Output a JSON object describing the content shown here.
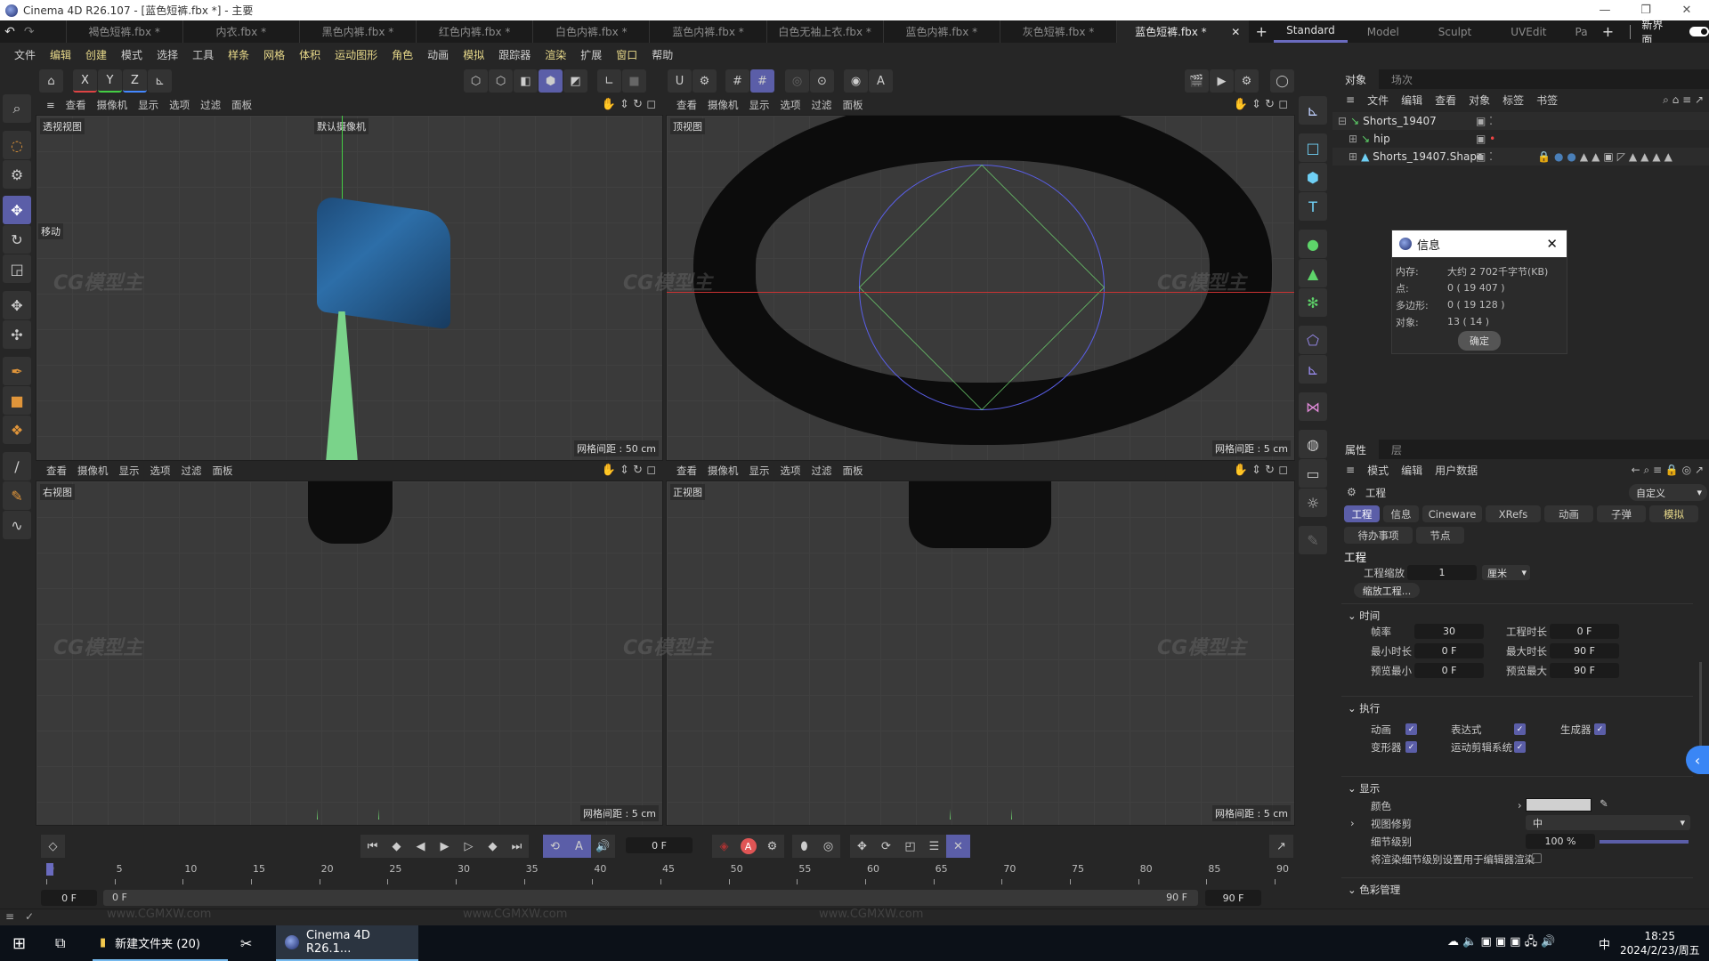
{
  "window": {
    "title": "Cinema 4D R26.107 - [蓝色短裤.fbx *] - 主要",
    "minimize": "—",
    "maximize": "❐",
    "close": "✕"
  },
  "file_tabs": [
    {
      "label": "褐色短裤.fbx *",
      "active": false
    },
    {
      "label": "内衣.fbx *",
      "active": false
    },
    {
      "label": "黑色内裤.fbx *",
      "active": false
    },
    {
      "label": "红色内裤.fbx *",
      "active": false
    },
    {
      "label": "白色内裤.fbx *",
      "active": false
    },
    {
      "label": "蓝色内裤.fbx *",
      "active": false
    },
    {
      "label": "白色无袖上衣.fbx *",
      "active": false
    },
    {
      "label": "蓝色内裤.fbx *",
      "active": false
    },
    {
      "label": "灰色短裤.fbx *",
      "active": false
    },
    {
      "label": "蓝色短裤.fbx *",
      "active": true
    }
  ],
  "layouts": [
    {
      "label": "Standard",
      "active": true
    },
    {
      "label": "Model",
      "active": false
    },
    {
      "label": "Sculpt",
      "active": false
    },
    {
      "label": "UVEdit",
      "active": false
    },
    {
      "label": "Pa",
      "active": false
    }
  ],
  "new_ui_label": "新界面",
  "menu": [
    {
      "label": "文件",
      "hl": false
    },
    {
      "label": "编辑",
      "hl": true
    },
    {
      "label": "创建",
      "hl": true
    },
    {
      "label": "模式",
      "hl": false
    },
    {
      "label": "选择",
      "hl": false
    },
    {
      "label": "工具",
      "hl": false
    },
    {
      "label": "样条",
      "hl": true
    },
    {
      "label": "网格",
      "hl": true
    },
    {
      "label": "体积",
      "hl": true
    },
    {
      "label": "运动图形",
      "hl": true
    },
    {
      "label": "角色",
      "hl": true
    },
    {
      "label": "动画",
      "hl": false
    },
    {
      "label": "模拟",
      "hl": true
    },
    {
      "label": "跟踪器",
      "hl": false
    },
    {
      "label": "渲染",
      "hl": true
    },
    {
      "label": "扩展",
      "hl": false
    },
    {
      "label": "窗口",
      "hl": true
    },
    {
      "label": "帮助",
      "hl": false
    }
  ],
  "toolbar": {
    "x": "X",
    "y": "Y",
    "z": "Z"
  },
  "viewport_menu": [
    "查看",
    "摄像机",
    "显示",
    "选项",
    "过滤",
    "面板"
  ],
  "viewports": {
    "perspective": {
      "label": "透视视图",
      "camera": "默认摄像机",
      "grid": "网格间距 : 50 cm",
      "tool_hint": "移动"
    },
    "top": {
      "label": "顶视图",
      "grid": "网格间距 : 5 cm"
    },
    "right": {
      "label": "右视图",
      "grid": "网格间距 : 5 cm"
    },
    "front": {
      "label": "正视图",
      "grid": "网格间距 : 5 cm"
    }
  },
  "object_manager": {
    "tabs": [
      "对象",
      "场次"
    ],
    "menu": [
      "文件",
      "编辑",
      "查看",
      "对象",
      "标签",
      "书签"
    ],
    "objects": [
      {
        "name": "Shorts_19407",
        "indent": 0
      },
      {
        "name": "hip",
        "indent": 1
      },
      {
        "name": "Shorts_19407.Shape",
        "indent": 1
      }
    ]
  },
  "info_dialog": {
    "title": "信息",
    "rows": [
      {
        "key": "内存:",
        "value": "大约 2 702千字节(KB)"
      },
      {
        "key": "点:",
        "value": "0 ( 19 407 )"
      },
      {
        "key": "多边形:",
        "value": "0 ( 19 128 )"
      },
      {
        "key": "对象:",
        "value": "13 ( 14 )"
      }
    ],
    "ok": "确定"
  },
  "attributes": {
    "tabs": [
      "属性",
      "层"
    ],
    "menu": [
      "模式",
      "编辑",
      "用户数据"
    ],
    "title": "工程",
    "preset": "自定义",
    "page_tabs": [
      "工程",
      "信息",
      "Cineware",
      "XRefs",
      "动画",
      "子弹",
      "模拟",
      "待办事项",
      "节点"
    ],
    "section": "工程",
    "scale_label": "工程缩放",
    "scale_value": "1",
    "scale_unit": "厘米",
    "scale_button": "缩放工程...",
    "time": {
      "header": "时间",
      "fps_label": "帧率",
      "fps": "30",
      "proj_len_label": "工程时长",
      "proj_len": "0 F",
      "min_label": "最小时长",
      "min": "0 F",
      "max_label": "最大时长",
      "max": "90 F",
      "pmin_label": "预览最小",
      "pmin": "0 F",
      "pmax_label": "预览最大",
      "pmax": "90 F"
    },
    "exec": {
      "header": "执行",
      "items": [
        {
          "label": "动画",
          "checked": true
        },
        {
          "label": "表达式",
          "checked": true
        },
        {
          "label": "生成器",
          "checked": true
        },
        {
          "label": "变形器",
          "checked": true
        },
        {
          "label": "运动剪辑系统",
          "checked": true
        }
      ]
    },
    "display": {
      "header": "显示",
      "color_label": "颜色",
      "color": "#d0d0d0",
      "clip_label": "视图修剪",
      "clip_value": "中",
      "lod_label": "细节级别",
      "lod_value": "100 %",
      "lod_fraction": 1.0,
      "render_lod_label": "将渲染细节级别设置用于编辑器渲染"
    },
    "color_mgmt": "色彩管理"
  },
  "timeline": {
    "current_frame": "0 F",
    "ticks": [
      "0",
      "5",
      "10",
      "15",
      "20",
      "25",
      "30",
      "35",
      "40",
      "45",
      "50",
      "55",
      "60",
      "65",
      "70",
      "75",
      "80",
      "85",
      "90"
    ],
    "start": "0 F",
    "range_start": "0 F",
    "range_end": "90 F",
    "end": "90 F"
  },
  "taskbar": {
    "folder": "新建文件夹 (20)",
    "app": "Cinema 4D R26.1...",
    "ime": "中",
    "time": "18:25",
    "date": "2024/2/23/周五"
  },
  "watermark": "www.CGMXW.com",
  "accent": "#5b5ea8"
}
